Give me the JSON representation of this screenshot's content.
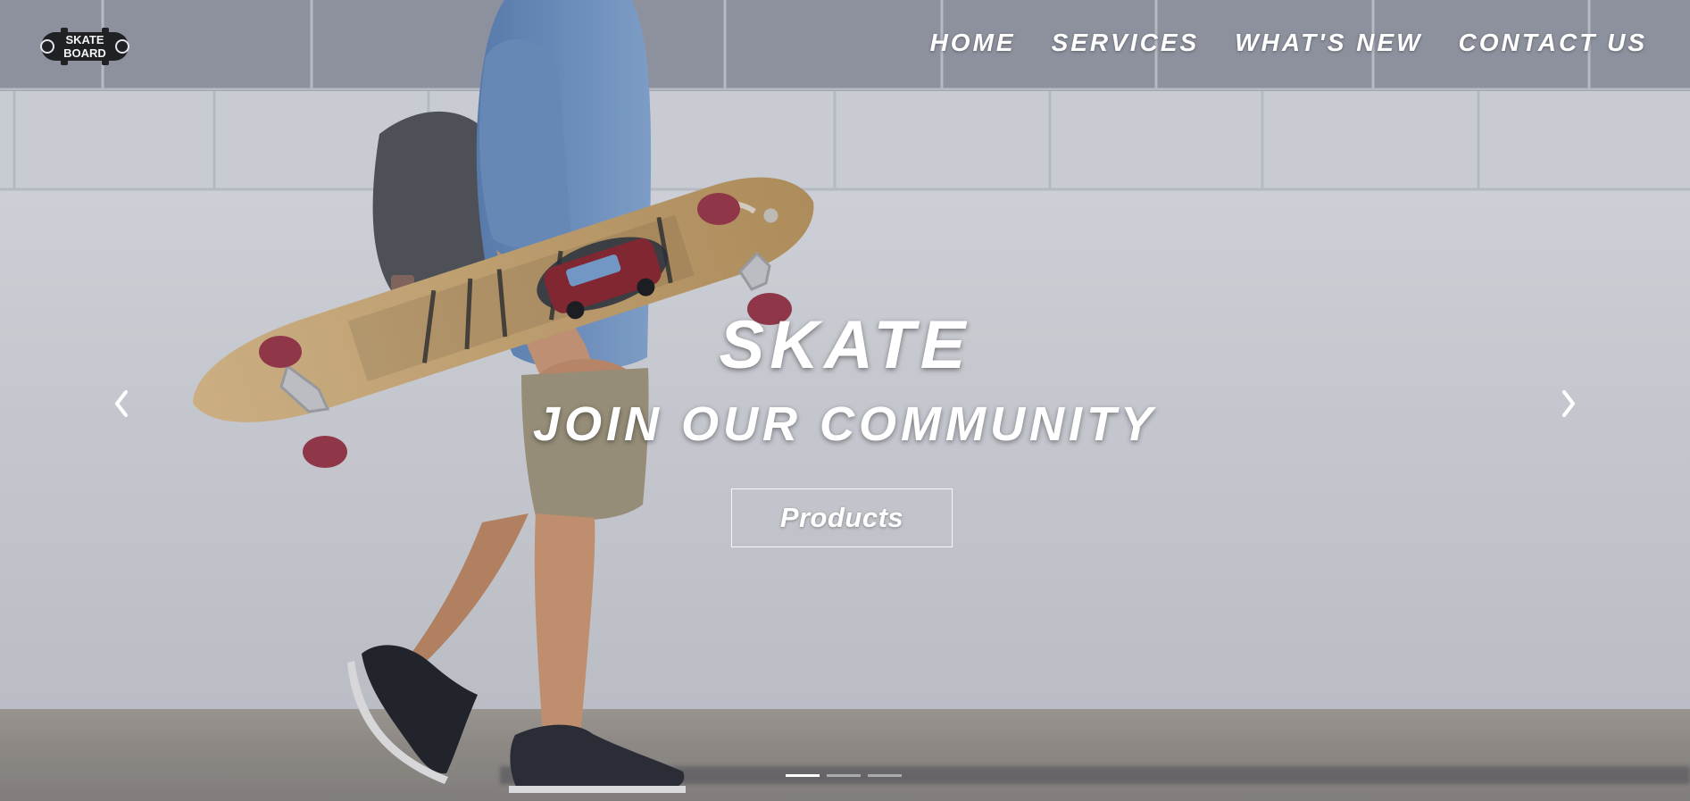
{
  "brand": {
    "logo_text_top": "SKATE",
    "logo_text_bottom": "BOARD"
  },
  "nav": {
    "items": [
      {
        "label": "HOME"
      },
      {
        "label": "SERVICES"
      },
      {
        "label": "WHAT'S NEW"
      },
      {
        "label": "CONTACT US"
      }
    ]
  },
  "hero": {
    "headline": "SKATE",
    "subhead": "JOIN OUR COMMUNITY",
    "cta_label": "Products"
  },
  "carousel": {
    "prev_icon": "chevron-left-icon",
    "next_icon": "chevron-right-icon",
    "slides": 3,
    "active_slide": 1
  },
  "colors": {
    "text": "#ffffff",
    "wall": "#d9dce2",
    "sky_band": "#9aa0ab",
    "board": "#d1b180",
    "shirt": "#6f95c4",
    "shorts": "#a19a7f",
    "backpack": "#54565d",
    "wheels": "#9d3b4d"
  }
}
